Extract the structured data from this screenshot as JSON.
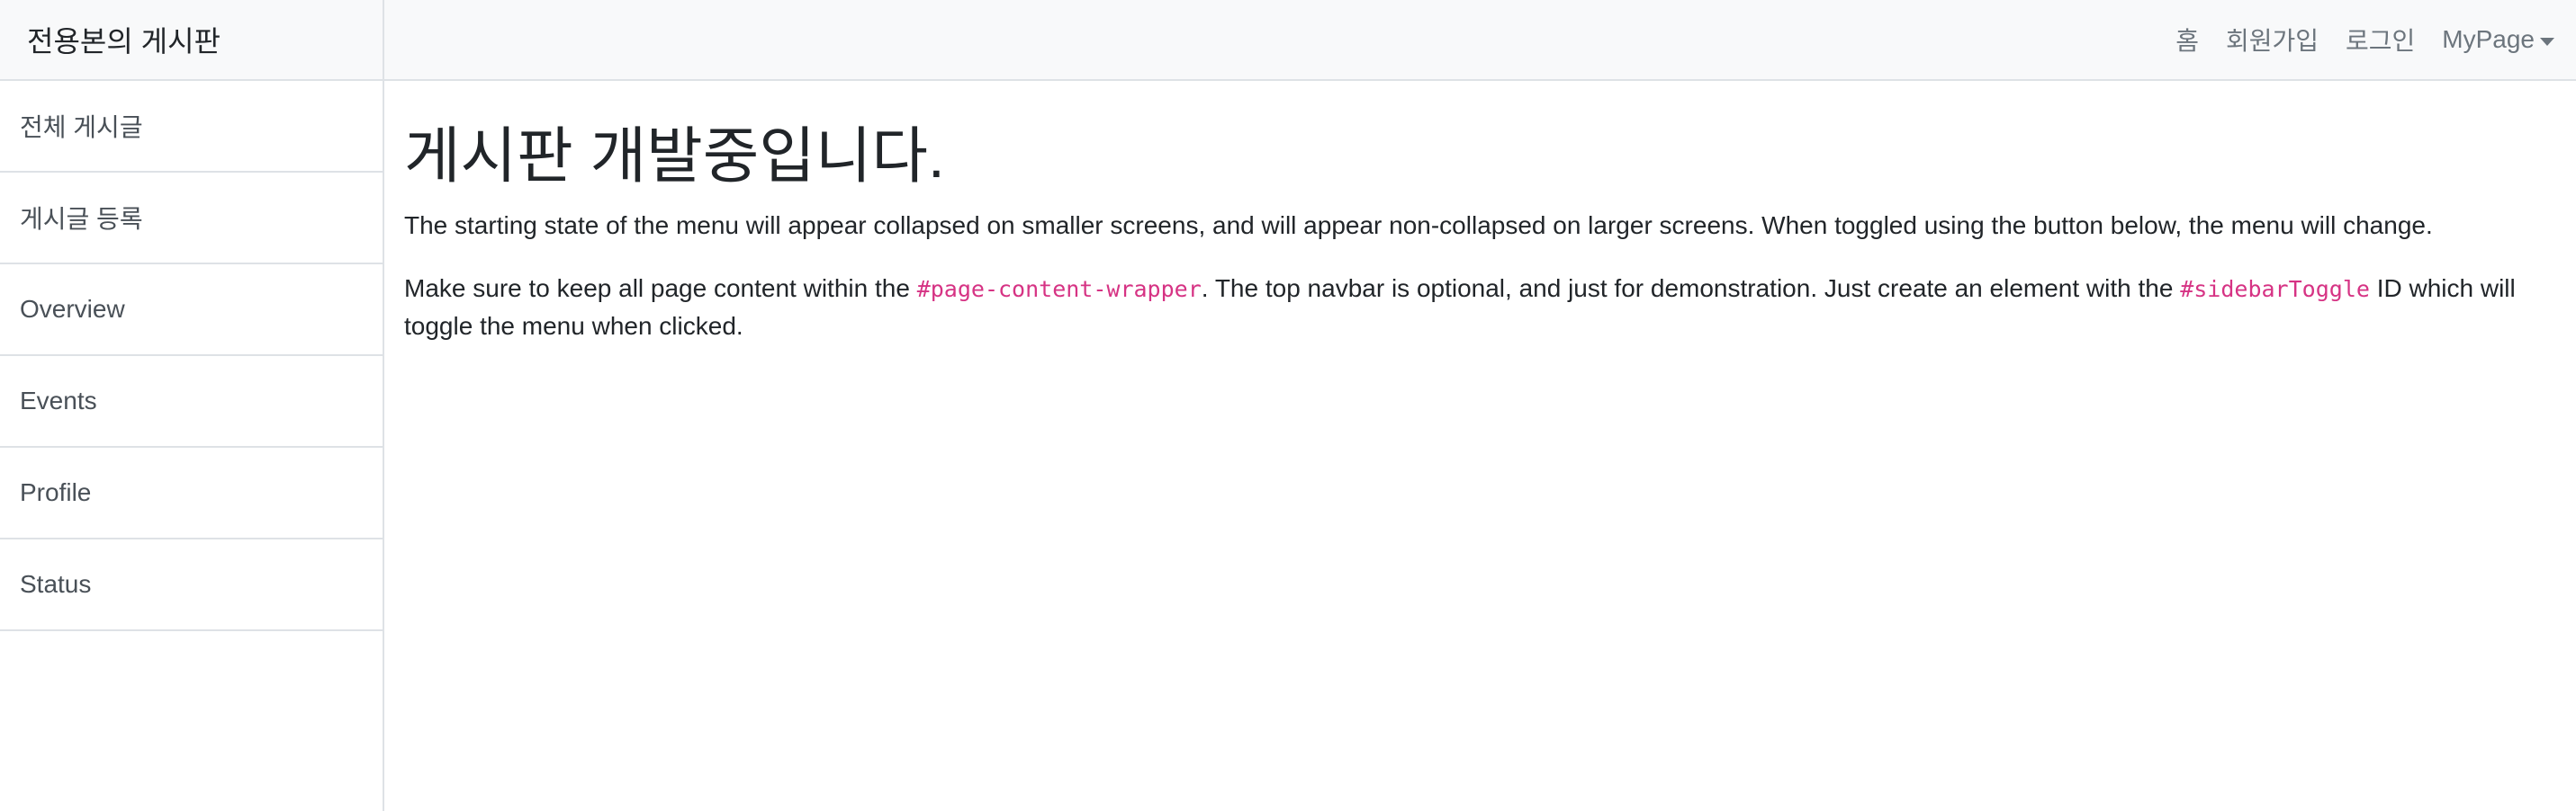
{
  "sidebar": {
    "heading": "전용본의 게시판",
    "items": [
      {
        "label": "전체 게시글"
      },
      {
        "label": "게시글 등록"
      },
      {
        "label": "Overview"
      },
      {
        "label": "Events"
      },
      {
        "label": "Profile"
      },
      {
        "label": "Status"
      }
    ]
  },
  "navbar": {
    "home": "홈",
    "signup": "회원가입",
    "login": "로그인",
    "mypage": "MyPage"
  },
  "main": {
    "title": "게시판 개발중입니다.",
    "para1": "The starting state of the menu will appear collapsed on smaller screens, and will appear non-collapsed on larger screens. When toggled using the button below, the menu will change.",
    "para2_a": "Make sure to keep all page content within the ",
    "para2_code1": "#page-content-wrapper",
    "para2_b": ". The top navbar is optional, and just for demonstration. Just create an element with the ",
    "para2_code2": "#sidebarToggle",
    "para2_c": " ID which will toggle the menu when clicked."
  },
  "colors": {
    "accent_code": "#d63384",
    "bar_bg": "#f8f9fa",
    "border": "#dee2e6"
  }
}
